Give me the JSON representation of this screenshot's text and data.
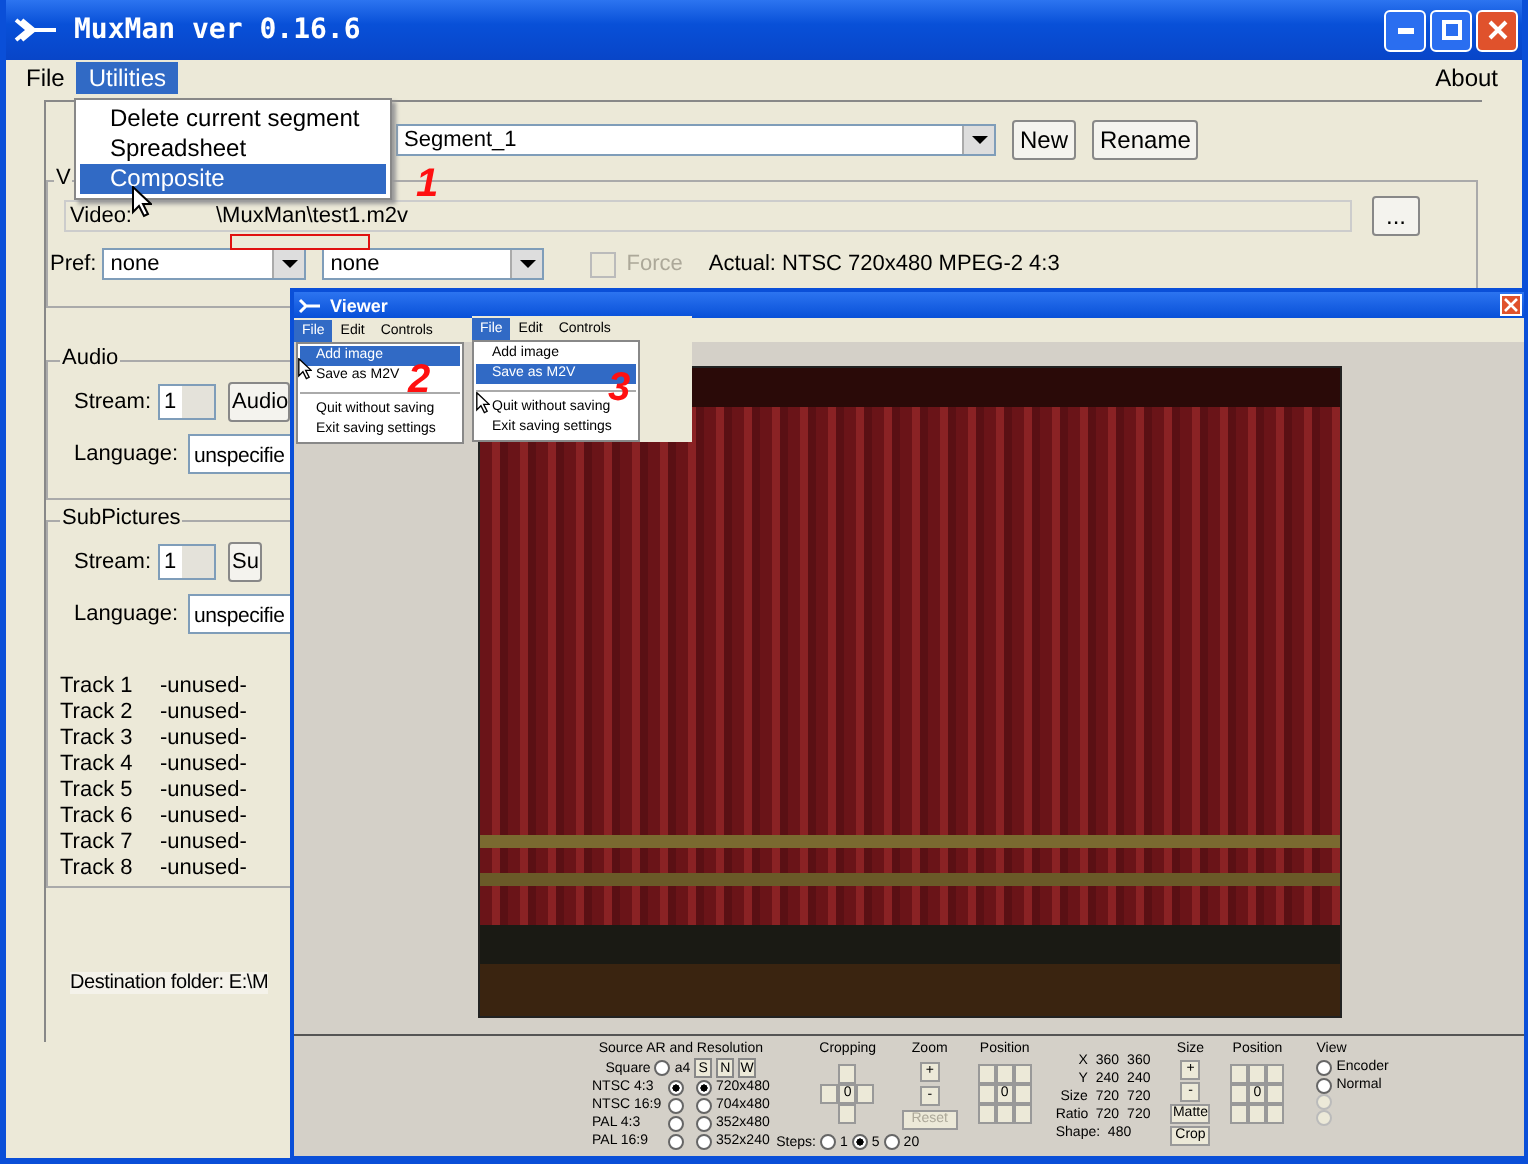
{
  "main_window": {
    "title": "MuxMan ver 0.16.6",
    "menubar": [
      {
        "label": "File",
        "selected": false
      },
      {
        "label": "Utilities",
        "selected": true
      }
    ],
    "about": "About",
    "utilities_menu": [
      {
        "label": "Delete current segment",
        "selected": false
      },
      {
        "label": "Spreadsheet",
        "selected": false
      },
      {
        "label": "Composite",
        "selected": true
      }
    ],
    "segment": {
      "value": "Segment_1",
      "new": "New",
      "rename": "Rename"
    },
    "video": {
      "legend": "V",
      "label": "Video:",
      "path": "\\MuxMan\\test1.m2v",
      "browse": "...",
      "pref_label": "Pref:",
      "pref_1": "none",
      "pref_2": "none",
      "force": {
        "label": "Force",
        "checked": false,
        "disabled": true
      },
      "actual": "Actual: NTSC 720x480  MPEG-2  4:3"
    },
    "audio": {
      "legend": "Audio",
      "stream_label": "Stream:",
      "stream": "1",
      "stream_button": "Audio",
      "language_label": "Language:",
      "language": "unspecifie"
    },
    "subpictures": {
      "legend": "SubPictures",
      "stream_label": "Stream:",
      "stream": "1",
      "stream_button": "Su",
      "language_label": "Language:",
      "language": "unspecifie",
      "tracks": [
        {
          "name": "Track 1",
          "status": "-unused-"
        },
        {
          "name": "Track 2",
          "status": "-unused-"
        },
        {
          "name": "Track 3",
          "status": "-unused-"
        },
        {
          "name": "Track 4",
          "status": "-unused-"
        },
        {
          "name": "Track 5",
          "status": "-unused-"
        },
        {
          "name": "Track 6",
          "status": "-unused-"
        },
        {
          "name": "Track 7",
          "status": "-unused-"
        },
        {
          "name": "Track 8",
          "status": "-unused-"
        }
      ]
    },
    "destination": "Destination folder: E:\\M"
  },
  "viewer": {
    "title": "Viewer",
    "menubar": [
      {
        "label": "File",
        "selected": true
      },
      {
        "label": "Edit",
        "selected": false
      },
      {
        "label": "Controls",
        "selected": false
      }
    ],
    "file_menu": [
      {
        "label": "Add image",
        "selected": true
      },
      {
        "label": "Save as M2V",
        "selected": false
      },
      {
        "label": "Quit without saving",
        "selected": false
      },
      {
        "label": "Exit saving settings",
        "selected": false
      }
    ],
    "inset": {
      "menubar": [
        {
          "label": "File",
          "selected": true
        },
        {
          "label": "Edit",
          "selected": false
        },
        {
          "label": "Controls",
          "selected": false
        }
      ],
      "file_menu": [
        {
          "label": "Add image",
          "selected": false
        },
        {
          "label": "Save as M2V",
          "selected": true
        },
        {
          "label": "Quit without saving",
          "selected": false
        },
        {
          "label": "Exit saving settings",
          "selected": false
        }
      ]
    },
    "controls": {
      "source": {
        "title": "Source AR and Resolution",
        "square_label": "Square",
        "square_selected": false,
        "aspect_note": "a4",
        "buttons": [
          "S",
          "N",
          "W"
        ],
        "aspects": [
          {
            "label": "NTSC 4:3",
            "selected": true
          },
          {
            "label": "NTSC 16:9",
            "selected": false
          },
          {
            "label": "PAL 4:3",
            "selected": false
          },
          {
            "label": "PAL 16:9",
            "selected": false
          }
        ],
        "resolutions": [
          {
            "label": "720x480",
            "selected": true
          },
          {
            "label": "704x480",
            "selected": false
          },
          {
            "label": "352x480",
            "selected": false
          },
          {
            "label": "352x240",
            "selected": false
          }
        ]
      },
      "cropping": {
        "title": "Cropping",
        "center": "0",
        "steps_label": "Steps:",
        "steps": [
          {
            "label": "1",
            "selected": false
          },
          {
            "label": "5",
            "selected": true
          },
          {
            "label": "20",
            "selected": false
          }
        ]
      },
      "zoom": {
        "title": "Zoom",
        "plus": "+",
        "minus": "-",
        "reset": "Reset"
      },
      "zoom_position": {
        "title": "Position",
        "center": "0"
      },
      "readout": [
        {
          "label": "X",
          "a": "360",
          "b": "360"
        },
        {
          "label": "Y",
          "a": "240",
          "b": "240"
        },
        {
          "label": "Size",
          "a": "720",
          "b": "720"
        },
        {
          "label": "Ratio",
          "a": "720",
          "b": "720"
        }
      ],
      "shape": "Shape:  480",
      "size": {
        "title": "Size",
        "plus": "+",
        "minus": "-",
        "matte": "Matte",
        "crop": "Crop"
      },
      "size_position": {
        "title": "Position",
        "center": "0"
      },
      "view": {
        "title": "View",
        "options": [
          {
            "label": "Encoder",
            "selected": false,
            "disabled": false
          },
          {
            "label": "Normal",
            "selected": false,
            "disabled": false
          },
          {
            "selected": false,
            "disabled": true
          },
          {
            "selected": false,
            "disabled": true
          }
        ]
      }
    }
  },
  "annotations": [
    {
      "kind": "outline"
    },
    {
      "kind": "number",
      "text": "1"
    },
    {
      "kind": "number",
      "text": "2"
    },
    {
      "kind": "number",
      "text": "3"
    }
  ]
}
